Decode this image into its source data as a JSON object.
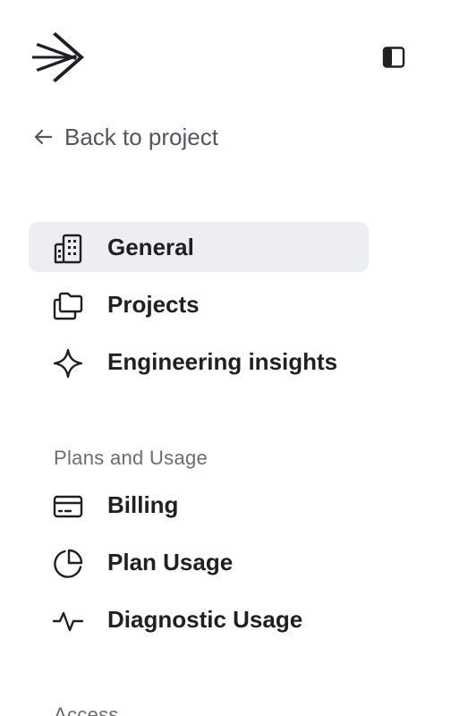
{
  "header": {
    "logo_icon": "arrow-burst-logo",
    "toggle_icon": "sidebar-panel-icon"
  },
  "back": {
    "label": "Back to project",
    "icon": "arrow-left-icon"
  },
  "nav": {
    "items": [
      {
        "label": "General",
        "icon": "building-icon",
        "active": true
      },
      {
        "label": "Projects",
        "icon": "folders-icon",
        "active": false
      },
      {
        "label": "Engineering insights",
        "icon": "sparkle-icon",
        "active": false
      }
    ]
  },
  "plans": {
    "title": "Plans and Usage",
    "items": [
      {
        "label": "Billing",
        "icon": "credit-card-icon"
      },
      {
        "label": "Plan Usage",
        "icon": "pie-chart-icon"
      },
      {
        "label": "Diagnostic Usage",
        "icon": "activity-icon"
      }
    ]
  },
  "access": {
    "title": "Access"
  },
  "colors": {
    "active_bg": "#eceef1",
    "text": "#1f2024",
    "muted": "#6b6c74"
  }
}
